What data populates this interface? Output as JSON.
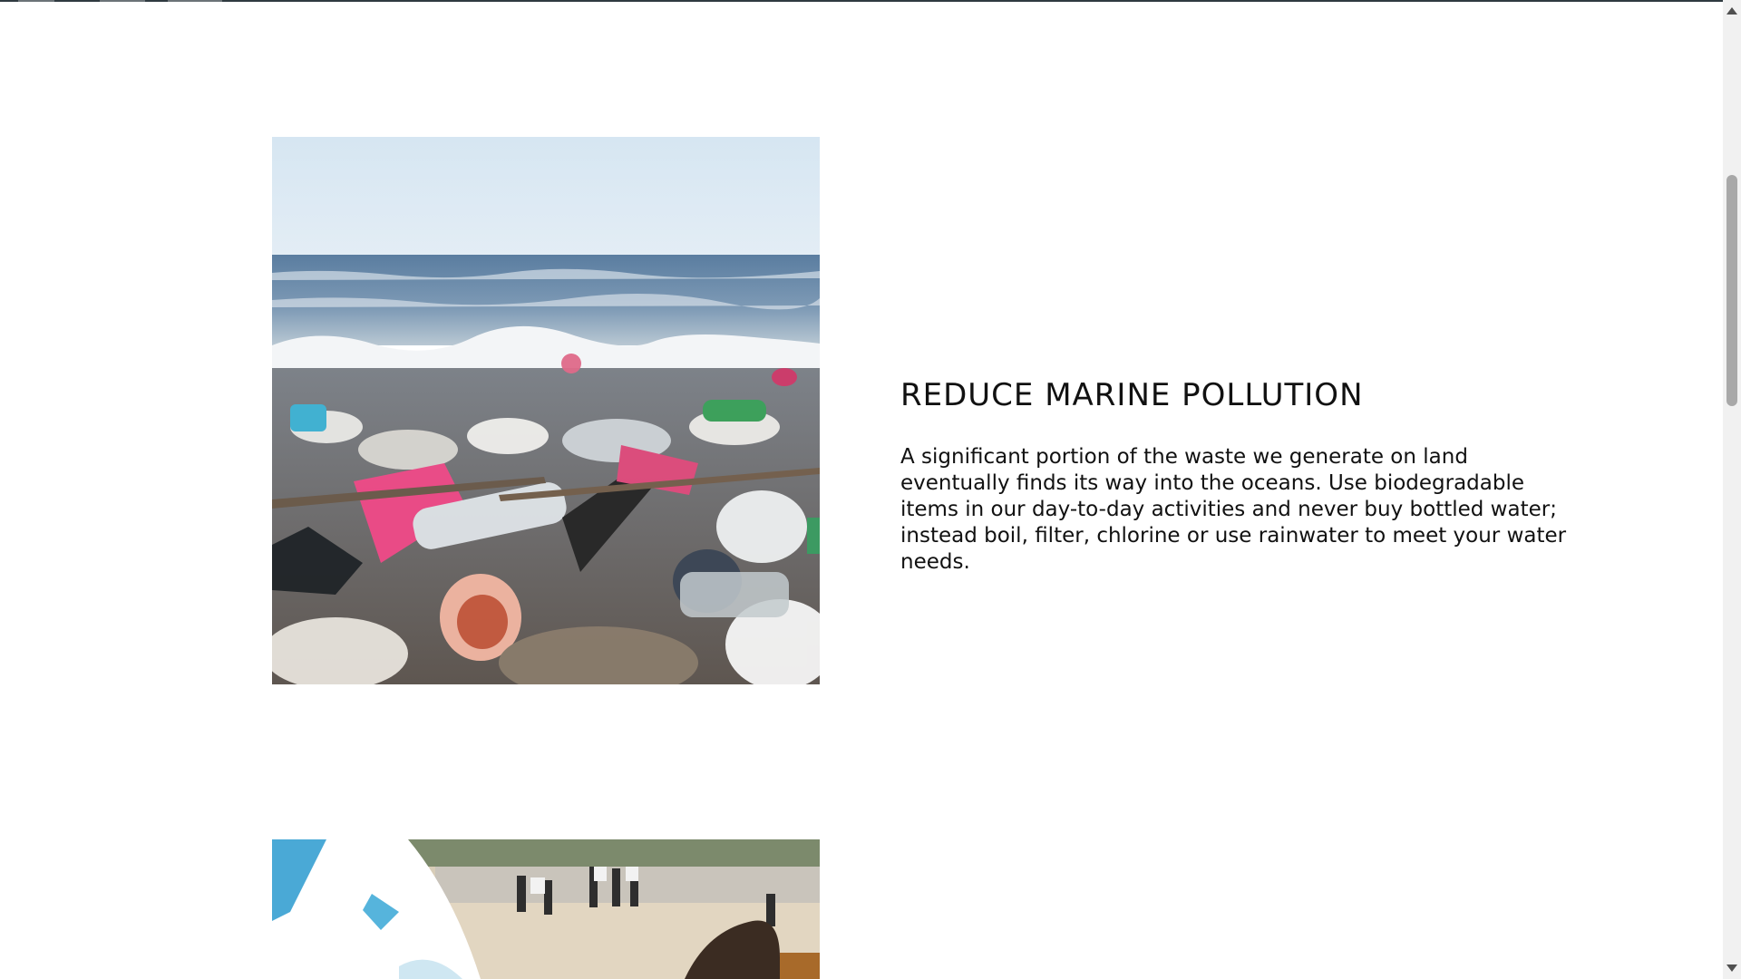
{
  "features": [
    {
      "image_alt": "Plastic waste washed up on a beach",
      "heading": "REDUCE MARINE POLLUTION",
      "body": "A significant portion of the waste we generate on land eventually finds its way into the oceans. Use biodegradable items in our day-to-day activities and never buy bottled water; instead boil, filter, chlorine or use rainwater to meet your water needs."
    },
    {
      "image_alt": "Volunteers cleaning up a beach"
    }
  ],
  "scrollbar": {
    "scroll_position_fraction": 0.22
  }
}
